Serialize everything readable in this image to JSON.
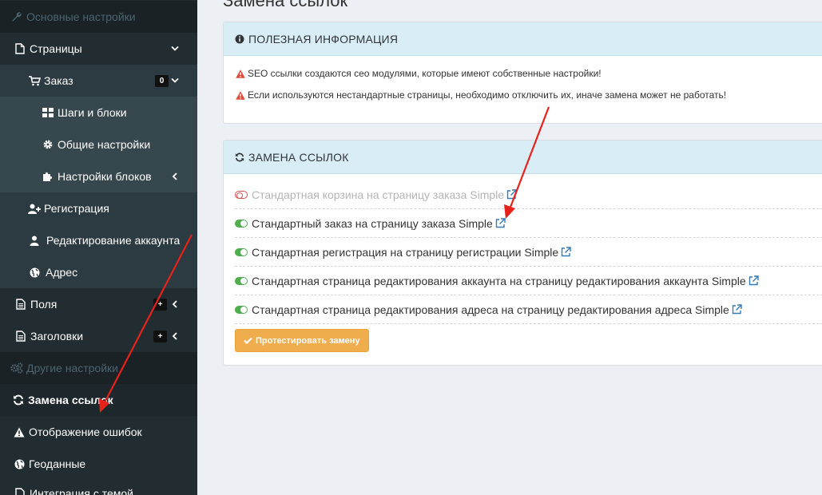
{
  "sidebar": {
    "items": [
      {
        "label": "Основные настройки",
        "icon": "wrench-icon"
      },
      {
        "label": "Страницы",
        "icon": "file-icon"
      },
      {
        "label": "Заказ",
        "icon": "cart-icon",
        "badge": "0"
      },
      {
        "label": "Шаги и блоки",
        "icon": "grid-icon"
      },
      {
        "label": "Общие настройки",
        "icon": "gear-icon"
      },
      {
        "label": "Настройки блоков",
        "icon": "puzzle-icon"
      },
      {
        "label": "Регистрация",
        "icon": "user-plus-icon"
      },
      {
        "label": "Редактирование аккаунта",
        "icon": "user-icon"
      },
      {
        "label": "Адрес",
        "icon": "globe-icon"
      },
      {
        "label": "Поля",
        "icon": "file-text-icon",
        "badge": "+"
      },
      {
        "label": "Заголовки",
        "icon": "file-text-icon",
        "badge": "+"
      },
      {
        "label": "Другие настройки",
        "icon": "gears-icon"
      },
      {
        "label": "Замена ссылок",
        "icon": "refresh-icon"
      },
      {
        "label": "Отображение ошибок",
        "icon": "warning-icon"
      },
      {
        "label": "Геоданные",
        "icon": "globe-icon"
      },
      {
        "label": "Интеграция с темой",
        "icon": "file-icon"
      }
    ]
  },
  "main": {
    "page_title": "Замена ссылок",
    "info_box": {
      "title": "ПОЛЕЗНАЯ ИНФОРМАЦИЯ",
      "lines": [
        "SEO ссылки создаются сео модулями, которые имеют собственные настройки!",
        "Если используются нестандартные страницы, необходимо отключить их, иначе замена может не работать!"
      ]
    },
    "swap_box": {
      "title": "ЗАМЕНА ССЫЛОК",
      "rows": [
        {
          "label": "Стандартная корзина на страницу заказа Simple",
          "enabled": false
        },
        {
          "label": "Стандартный заказ на страницу заказа Simple",
          "enabled": true
        },
        {
          "label": "Стандартная регистрация на страницу регистрации Simple",
          "enabled": true
        },
        {
          "label": "Стандартная страница редактирования аккаунта на страницу редактирования аккаунта Simple",
          "enabled": true
        },
        {
          "label": "Стандартная страница редактирования адреса на страницу редактирования адреса Simple",
          "enabled": true
        }
      ],
      "button_label": "Протестировать замену"
    }
  },
  "colors": {
    "sidebar_bg": "#222d32",
    "info_header_bg": "#d9edf7",
    "toggle_on": "#4cae4c",
    "toggle_off": "#d9534f",
    "link_icon": "#337ab7",
    "button_bg": "#f0ad4e",
    "warning_icon": "#dd4b39",
    "annotation_arrow": "#e8211b"
  }
}
